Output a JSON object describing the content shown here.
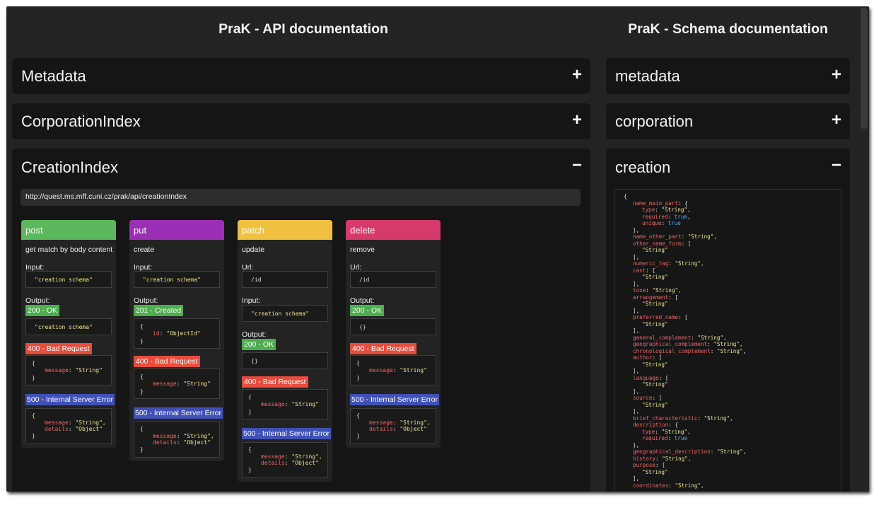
{
  "api_title": "PraK - API documentation",
  "schema_title": "PraK - Schema documentation",
  "api_panels": [
    {
      "title": "Metadata",
      "toggle": "+"
    },
    {
      "title": "CorporationIndex",
      "toggle": "+"
    },
    {
      "title": "CreationIndex",
      "toggle": "−"
    }
  ],
  "creation": {
    "url": "http://quest.ms.mff.cuni.cz/prak/api/creationIndex",
    "cards": {
      "post": {
        "method": "post",
        "color": "#5cb85c",
        "description": "get match by body content",
        "input_label": "Input:",
        "input_value": "\"creation schema\"",
        "output_label": "Output:",
        "ok_badge": "200 - OK",
        "ok_value": "\"creation schema\"",
        "bad_badge": "400 - Bad Request",
        "bad_open": "{",
        "bad_key": "message",
        "bad_val": "\"String\"",
        "bad_close": "}",
        "err_badge": "500 - Internal Server Error",
        "err_open": "{",
        "err_k1": "message",
        "err_v1": "\"String\",",
        "err_k2": "details",
        "err_v2": "\"Object\"",
        "err_close": "}"
      },
      "put": {
        "method": "put",
        "color": "#9b30b6",
        "description": "create",
        "input_label": "Input:",
        "input_value": "\"creation schema\"",
        "output_label": "Output:",
        "ok_badge": "201 - Created",
        "ok_open": "{",
        "ok_key": "id",
        "ok_val": "\"ObjectId\"",
        "ok_close": "}",
        "bad_badge": "400 - Bad Request",
        "bad_open": "{",
        "bad_key": "message",
        "bad_val": "\"String\"",
        "bad_close": "}",
        "err_badge": "500 - Internal Server Error",
        "err_open": "{",
        "err_k1": "message",
        "err_v1": "\"String\",",
        "err_k2": "details",
        "err_v2": "\"Object\"",
        "err_close": "}"
      },
      "patch": {
        "method": "patch",
        "color": "#f0c040",
        "description": "update",
        "url_label": "Url:",
        "url_value": "/id",
        "input_label": "Input:",
        "input_value": "\"creation schema\"",
        "output_label": "Output:",
        "ok_badge": "200 - OK",
        "ok_value": "{}",
        "bad_badge": "400 - Bad Request",
        "bad_open": "{",
        "bad_key": "message",
        "bad_val": "\"String\"",
        "bad_close": "}",
        "err_badge": "500 - Internal Server Error",
        "err_open": "{",
        "err_k1": "message",
        "err_v1": "\"String\",",
        "err_k2": "details",
        "err_v2": "\"Object\"",
        "err_close": "}"
      },
      "delete": {
        "method": "delete",
        "color": "#d63a6a",
        "description": "remove",
        "url_label": "Url:",
        "url_value": "/id",
        "output_label": "Output:",
        "ok_badge": "200 - OK",
        "ok_value": "{}",
        "bad_badge": "400 - Bad Request",
        "bad_open": "{",
        "bad_key": "message",
        "bad_val": "\"String\"",
        "bad_close": "}",
        "err_badge": "500 - Internal Server Error",
        "err_open": "{",
        "err_k1": "message",
        "err_v1": "\"String\",",
        "err_k2": "details",
        "err_v2": "\"Object\"",
        "err_close": "}"
      }
    }
  },
  "schema_panels": [
    {
      "title": "metadata",
      "toggle": "+"
    },
    {
      "title": "corporation",
      "toggle": "+"
    },
    {
      "title": "creation",
      "toggle": "−"
    }
  ],
  "schema_lines": [
    {
      "indent": 0,
      "parts": [
        {
          "t": "p",
          "v": "{"
        }
      ]
    },
    {
      "indent": 1,
      "parts": [
        {
          "t": "k",
          "v": "name_main_part"
        },
        {
          "t": "p",
          "v": ": {"
        }
      ]
    },
    {
      "indent": 2,
      "parts": [
        {
          "t": "k",
          "v": "type"
        },
        {
          "t": "p",
          "v": ": "
        },
        {
          "t": "s",
          "v": "\"String\""
        },
        {
          "t": "p",
          "v": ","
        }
      ]
    },
    {
      "indent": 2,
      "parts": [
        {
          "t": "k",
          "v": "required"
        },
        {
          "t": "p",
          "v": ": "
        },
        {
          "t": "b",
          "v": "true"
        },
        {
          "t": "p",
          "v": ","
        }
      ]
    },
    {
      "indent": 2,
      "parts": [
        {
          "t": "k",
          "v": "unique"
        },
        {
          "t": "p",
          "v": ": "
        },
        {
          "t": "b",
          "v": "true"
        }
      ]
    },
    {
      "indent": 1,
      "parts": [
        {
          "t": "p",
          "v": "},"
        }
      ]
    },
    {
      "indent": 1,
      "parts": [
        {
          "t": "k",
          "v": "name_other_part"
        },
        {
          "t": "p",
          "v": ": "
        },
        {
          "t": "s",
          "v": "\"String\""
        },
        {
          "t": "p",
          "v": ","
        }
      ]
    },
    {
      "indent": 1,
      "parts": [
        {
          "t": "k",
          "v": "other_name_form"
        },
        {
          "t": "p",
          "v": ": ["
        }
      ]
    },
    {
      "indent": 2,
      "parts": [
        {
          "t": "s",
          "v": "\"String\""
        }
      ]
    },
    {
      "indent": 1,
      "parts": [
        {
          "t": "p",
          "v": "],"
        }
      ]
    },
    {
      "indent": 1,
      "parts": [
        {
          "t": "k",
          "v": "numeric_tag"
        },
        {
          "t": "p",
          "v": ": "
        },
        {
          "t": "s",
          "v": "\"String\""
        },
        {
          "t": "p",
          "v": ","
        }
      ]
    },
    {
      "indent": 1,
      "parts": [
        {
          "t": "k",
          "v": "cast"
        },
        {
          "t": "p",
          "v": ": ["
        }
      ]
    },
    {
      "indent": 2,
      "parts": [
        {
          "t": "s",
          "v": "\"String\""
        }
      ]
    },
    {
      "indent": 1,
      "parts": [
        {
          "t": "p",
          "v": "],"
        }
      ]
    },
    {
      "indent": 1,
      "parts": [
        {
          "t": "k",
          "v": "tone"
        },
        {
          "t": "p",
          "v": ": "
        },
        {
          "t": "s",
          "v": "\"String\""
        },
        {
          "t": "p",
          "v": ","
        }
      ]
    },
    {
      "indent": 1,
      "parts": [
        {
          "t": "k",
          "v": "arrangement"
        },
        {
          "t": "p",
          "v": ": ["
        }
      ]
    },
    {
      "indent": 2,
      "parts": [
        {
          "t": "s",
          "v": "\"String\""
        }
      ]
    },
    {
      "indent": 1,
      "parts": [
        {
          "t": "p",
          "v": "],"
        }
      ]
    },
    {
      "indent": 1,
      "parts": [
        {
          "t": "k",
          "v": "preferred_name"
        },
        {
          "t": "p",
          "v": ": ["
        }
      ]
    },
    {
      "indent": 2,
      "parts": [
        {
          "t": "s",
          "v": "\"String\""
        }
      ]
    },
    {
      "indent": 1,
      "parts": [
        {
          "t": "p",
          "v": "],"
        }
      ]
    },
    {
      "indent": 1,
      "parts": [
        {
          "t": "k",
          "v": "general_complement"
        },
        {
          "t": "p",
          "v": ": "
        },
        {
          "t": "s",
          "v": "\"String\""
        },
        {
          "t": "p",
          "v": ","
        }
      ]
    },
    {
      "indent": 1,
      "parts": [
        {
          "t": "k",
          "v": "geographical_complement"
        },
        {
          "t": "p",
          "v": ": "
        },
        {
          "t": "s",
          "v": "\"String\""
        },
        {
          "t": "p",
          "v": ","
        }
      ]
    },
    {
      "indent": 1,
      "parts": [
        {
          "t": "k",
          "v": "chronological_complement"
        },
        {
          "t": "p",
          "v": ": "
        },
        {
          "t": "s",
          "v": "\"String\""
        },
        {
          "t": "p",
          "v": ","
        }
      ]
    },
    {
      "indent": 1,
      "parts": [
        {
          "t": "k",
          "v": "author"
        },
        {
          "t": "p",
          "v": ": ["
        }
      ]
    },
    {
      "indent": 2,
      "parts": [
        {
          "t": "s",
          "v": "\"String\""
        }
      ]
    },
    {
      "indent": 1,
      "parts": [
        {
          "t": "p",
          "v": "],"
        }
      ]
    },
    {
      "indent": 1,
      "parts": [
        {
          "t": "k",
          "v": "language"
        },
        {
          "t": "p",
          "v": ": ["
        }
      ]
    },
    {
      "indent": 2,
      "parts": [
        {
          "t": "s",
          "v": "\"String\""
        }
      ]
    },
    {
      "indent": 1,
      "parts": [
        {
          "t": "p",
          "v": "],"
        }
      ]
    },
    {
      "indent": 1,
      "parts": [
        {
          "t": "k",
          "v": "source"
        },
        {
          "t": "p",
          "v": ": ["
        }
      ]
    },
    {
      "indent": 2,
      "parts": [
        {
          "t": "s",
          "v": "\"String\""
        }
      ]
    },
    {
      "indent": 1,
      "parts": [
        {
          "t": "p",
          "v": "],"
        }
      ]
    },
    {
      "indent": 1,
      "parts": [
        {
          "t": "k",
          "v": "brief_characteristic"
        },
        {
          "t": "p",
          "v": ": "
        },
        {
          "t": "s",
          "v": "\"String\""
        },
        {
          "t": "p",
          "v": ","
        }
      ]
    },
    {
      "indent": 1,
      "parts": [
        {
          "t": "k",
          "v": "description"
        },
        {
          "t": "p",
          "v": ": {"
        }
      ]
    },
    {
      "indent": 2,
      "parts": [
        {
          "t": "k",
          "v": "type"
        },
        {
          "t": "p",
          "v": ": "
        },
        {
          "t": "s",
          "v": "\"String\""
        },
        {
          "t": "p",
          "v": ","
        }
      ]
    },
    {
      "indent": 2,
      "parts": [
        {
          "t": "k",
          "v": "required"
        },
        {
          "t": "p",
          "v": ": "
        },
        {
          "t": "b",
          "v": "true"
        }
      ]
    },
    {
      "indent": 1,
      "parts": [
        {
          "t": "p",
          "v": "},"
        }
      ]
    },
    {
      "indent": 1,
      "parts": [
        {
          "t": "k",
          "v": "geographical_description"
        },
        {
          "t": "p",
          "v": ": "
        },
        {
          "t": "s",
          "v": "\"String\""
        },
        {
          "t": "p",
          "v": ","
        }
      ]
    },
    {
      "indent": 1,
      "parts": [
        {
          "t": "k",
          "v": "history"
        },
        {
          "t": "p",
          "v": ": "
        },
        {
          "t": "s",
          "v": "\"String\""
        },
        {
          "t": "p",
          "v": ","
        }
      ]
    },
    {
      "indent": 1,
      "parts": [
        {
          "t": "k",
          "v": "purpose"
        },
        {
          "t": "p",
          "v": ": ["
        }
      ]
    },
    {
      "indent": 2,
      "parts": [
        {
          "t": "s",
          "v": "\"String\""
        }
      ]
    },
    {
      "indent": 1,
      "parts": [
        {
          "t": "p",
          "v": "],"
        }
      ]
    },
    {
      "indent": 1,
      "parts": [
        {
          "t": "k",
          "v": "coordinates"
        },
        {
          "t": "p",
          "v": ": "
        },
        {
          "t": "s",
          "v": "\"String\""
        },
        {
          "t": "p",
          "v": ","
        }
      ]
    }
  ],
  "colors": {
    "ok": "#4cae4c",
    "bad_request": "#e74c3c",
    "server_error": "#3f51b5"
  }
}
